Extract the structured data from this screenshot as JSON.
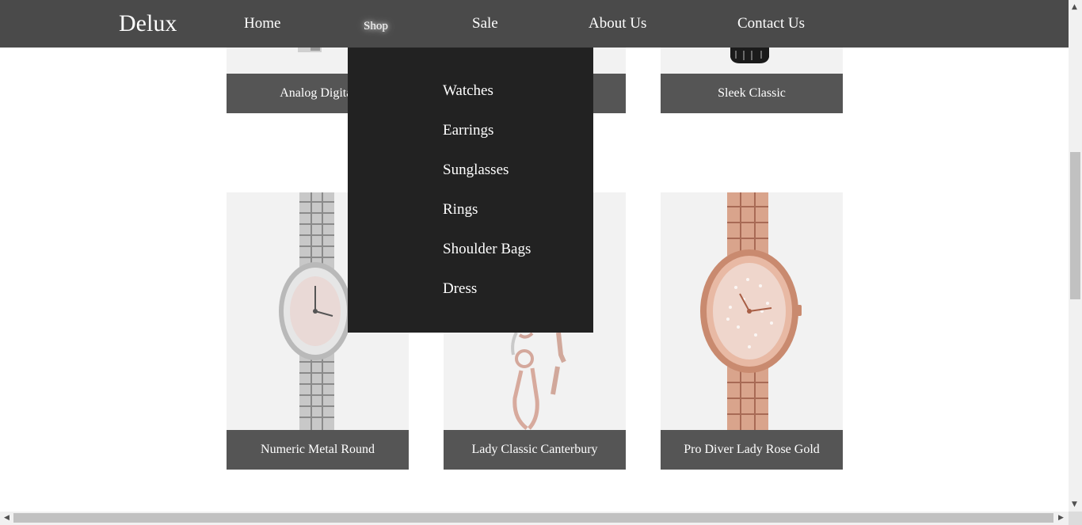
{
  "nav": {
    "logo": "Delux",
    "links": [
      "Home",
      "Shop",
      "Sale",
      "About Us",
      "Contact Us"
    ]
  },
  "dropdown": {
    "items": [
      "Watches",
      "Earrings",
      "Sunglasses",
      "Rings",
      "Shoulder Bags",
      "Dress"
    ]
  },
  "products": {
    "top": [
      "Analog Digital",
      "",
      "Sleek Classic"
    ],
    "bottom": [
      "Numeric Metal Round",
      "Lady Classic Canterbury",
      "Pro Diver Lady Rose Gold"
    ]
  },
  "colors": {
    "nav_bg": "#4a4a4a",
    "dropdown_bg": "#222222",
    "label_bg": "#555555",
    "image_bg": "#f2f2f2"
  }
}
